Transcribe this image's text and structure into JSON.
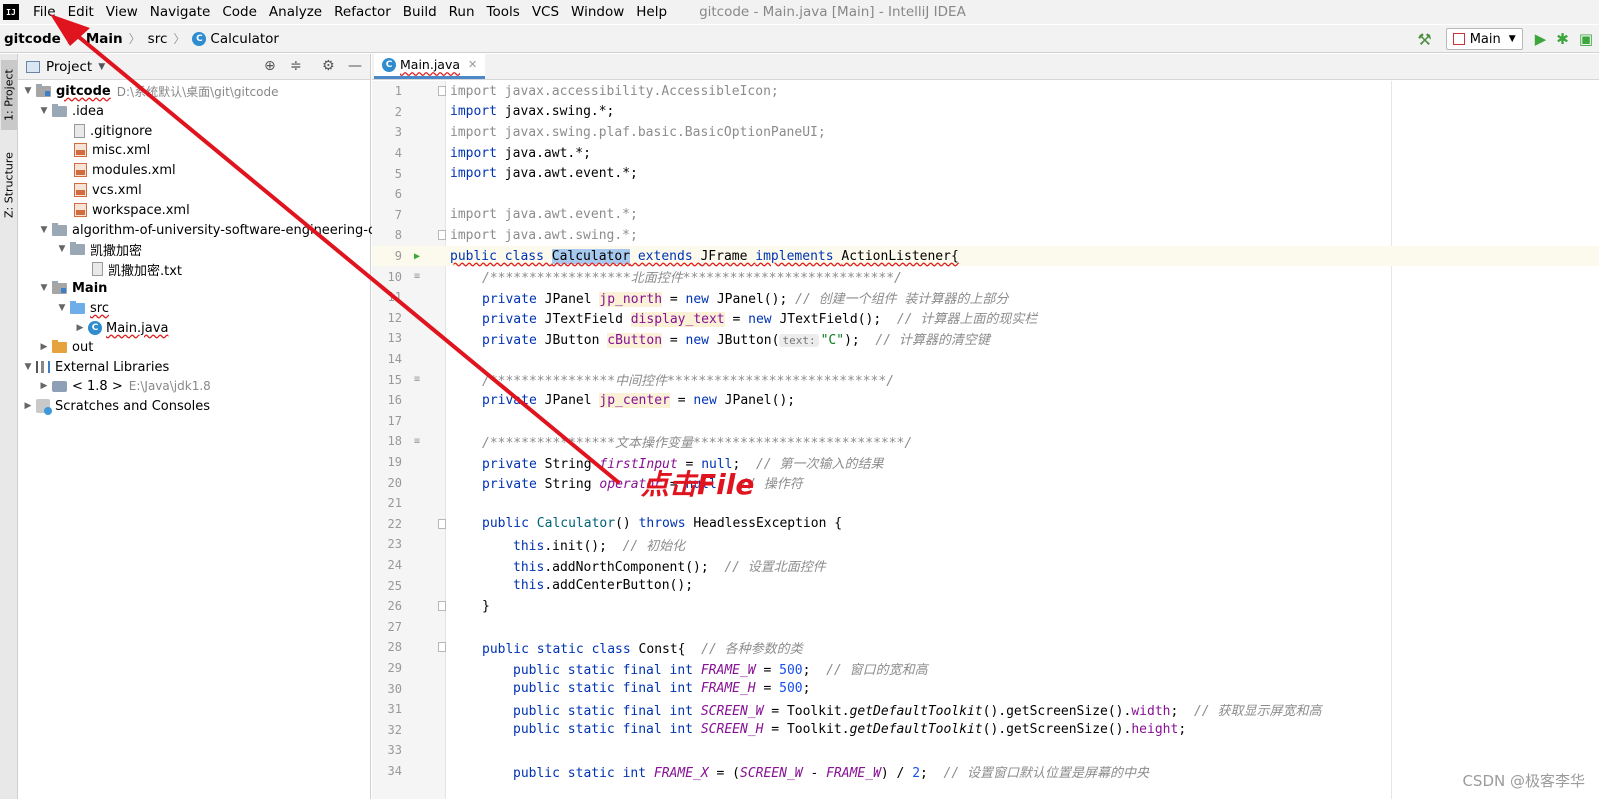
{
  "menubar": {
    "logo": "IJ",
    "items": [
      "File",
      "Edit",
      "View",
      "Navigate",
      "Code",
      "Analyze",
      "Refactor",
      "Build",
      "Run",
      "Tools",
      "VCS",
      "Window",
      "Help"
    ],
    "window_title": "gitcode - Main.java [Main] - IntelliJ IDEA"
  },
  "navbar": {
    "crumbs": [
      "gitcode",
      "Main",
      "src",
      "Calculator"
    ],
    "run_config": "Main"
  },
  "tool_strip": {
    "project_tab": "1: Project",
    "structure_tab": "Z: Structure"
  },
  "project": {
    "title": "Project",
    "tree": [
      {
        "label": "gitcode",
        "hint": "D:\\系统默认\\桌面\\git\\gitcode"
      },
      {
        "label": ".idea"
      },
      {
        "label": ".gitignore"
      },
      {
        "label": "misc.xml"
      },
      {
        "label": "modules.xml"
      },
      {
        "label": "vcs.xml"
      },
      {
        "label": "workspace.xml"
      },
      {
        "label": "algorithm-of-university-software-engineering-course"
      },
      {
        "label": "凯撒加密"
      },
      {
        "label": "凯撒加密.txt"
      },
      {
        "label": "Main"
      },
      {
        "label": "src"
      },
      {
        "label": "Main.java"
      },
      {
        "label": "out"
      },
      {
        "label": "External Libraries"
      },
      {
        "label": "< 1.8 >",
        "hint": "E:\\Java\\jdk1.8"
      },
      {
        "label": "Scratches and Consoles"
      }
    ]
  },
  "editor": {
    "tab_label": "Main.java",
    "line_numbers": [
      "1",
      "2",
      "3",
      "4",
      "5",
      "6",
      "7",
      "8",
      "9",
      "10",
      "11",
      "12",
      "13",
      "14",
      "15",
      "16",
      "17",
      "18",
      "19",
      "20",
      "21",
      "22",
      "23",
      "24",
      "25",
      "26",
      "27",
      "28",
      "29",
      "30",
      "31",
      "32",
      "33",
      "34"
    ],
    "lines": {
      "l1": "import javax.accessibility.AccessibleIcon;",
      "l2a": "import ",
      "l2b": "javax.swing.*;",
      "l3": "import javax.swing.plaf.basic.BasicOptionPaneUI;",
      "l4a": "import ",
      "l4b": "java.awt.*;",
      "l5a": "import ",
      "l5b": "java.awt.event.*;",
      "l7": "import java.awt.event.*;",
      "l8": "import java.awt.swing.*;",
      "l9a": "public class ",
      "l9b": "Calculator",
      "l9c": " extends ",
      "l9d": "JFrame ",
      "l9e": "implements ",
      "l9f": "ActionListener{",
      "l10": "/******************北面控件***************************/",
      "l11a": "private ",
      "l11b": "JPanel ",
      "l11c": "jp_north",
      "l11d": " = ",
      "l11e": "new ",
      "l11f": "JPanel(); ",
      "l11g": "// 创建一个组件 装计算器的上部分",
      "l12a": "private ",
      "l12b": "JTextField ",
      "l12c": "display_text",
      "l12d": " = ",
      "l12e": "new ",
      "l12f": "JTextField();  ",
      "l12g": "// 计算器上面的现实栏",
      "l13a": "private ",
      "l13b": "JButton ",
      "l13c": "cButton",
      "l13d": " = ",
      "l13e": "new ",
      "l13f": "JButton(",
      "l13h": "text:",
      "l13s": "\"C\"",
      "l13i": ");  ",
      "l13g": "// 计算器的清空键",
      "l15": "/****************中间控件****************************/",
      "l16a": "private ",
      "l16b": "JPanel ",
      "l16c": "jp_center",
      "l16d": " = ",
      "l16e": "new ",
      "l16f": "JPanel();",
      "l18": "/****************文本操作变量***************************/",
      "l19a": "private ",
      "l19b": "String ",
      "l19c": "firstInput",
      "l19d": " = ",
      "l19e": "null",
      "l19f": ";  ",
      "l19g": "// 第一次输入的结果",
      "l20a": "private ",
      "l20b": "String ",
      "l20c": "operator",
      "l20d": " = ",
      "l20e": "null",
      "l20f": ";  ",
      "l20g": "// 操作符",
      "l22a": "public ",
      "l22b": "Calculator",
      "l22c": "() ",
      "l22d": "throws ",
      "l22e": "HeadlessException {",
      "l23a": "this",
      "l23b": ".init();  ",
      "l23c": "// 初始化",
      "l24a": "this",
      "l24b": ".addNorthComponent();  ",
      "l24c": "// 设置北面控件",
      "l25a": "this",
      "l25b": ".addCenterButton();",
      "l26": "}",
      "l28a": "public static class ",
      "l28b": "Const{  ",
      "l28c": "// 各种参数的类",
      "l29a": "public static final int ",
      "l29b": "FRAME_W",
      "l29c": " = ",
      "l29d": "500",
      "l29e": ";  ",
      "l29f": "// 窗口的宽和高",
      "l30a": "public static final int ",
      "l30b": "FRAME_H",
      "l30c": " = ",
      "l30d": "500",
      "l30e": ";",
      "l31a": "public static final int ",
      "l31b": "SCREEN_W",
      "l31c": " = Toolkit.",
      "l31d": "getDefaultToolkit",
      "l31e": "().getScreenSize().",
      "l31f": "width",
      "l31g": ";  ",
      "l31h": "// 获取显示屏宽和高",
      "l32a": "public static final int ",
      "l32b": "SCREEN_H",
      "l32c": " = Toolkit.",
      "l32d": "getDefaultToolkit",
      "l32e": "().getScreenSize().",
      "l32f": "height",
      "l32g": ";",
      "l34a": "public static int ",
      "l34b": "FRAME_X",
      "l34c": " = (",
      "l34d": "SCREEN_W",
      "l34e": " - ",
      "l34f": "FRAME_W",
      "l34g": ") / ",
      "l34h": "2",
      "l34i": ";  ",
      "l34j": "// 设置窗口默认位置是屏幕的中央"
    }
  },
  "annotation": {
    "text": "点击File",
    "color": "#e0141e"
  },
  "watermark": "CSDN @极客李华",
  "colors": {
    "keyword": "#0033b3",
    "field": "#871094",
    "comment": "#8c8c8c",
    "number": "#1750eb",
    "string": "#067d17",
    "selection": "#a8c9ee",
    "tab_underline": "#4a88c7"
  }
}
